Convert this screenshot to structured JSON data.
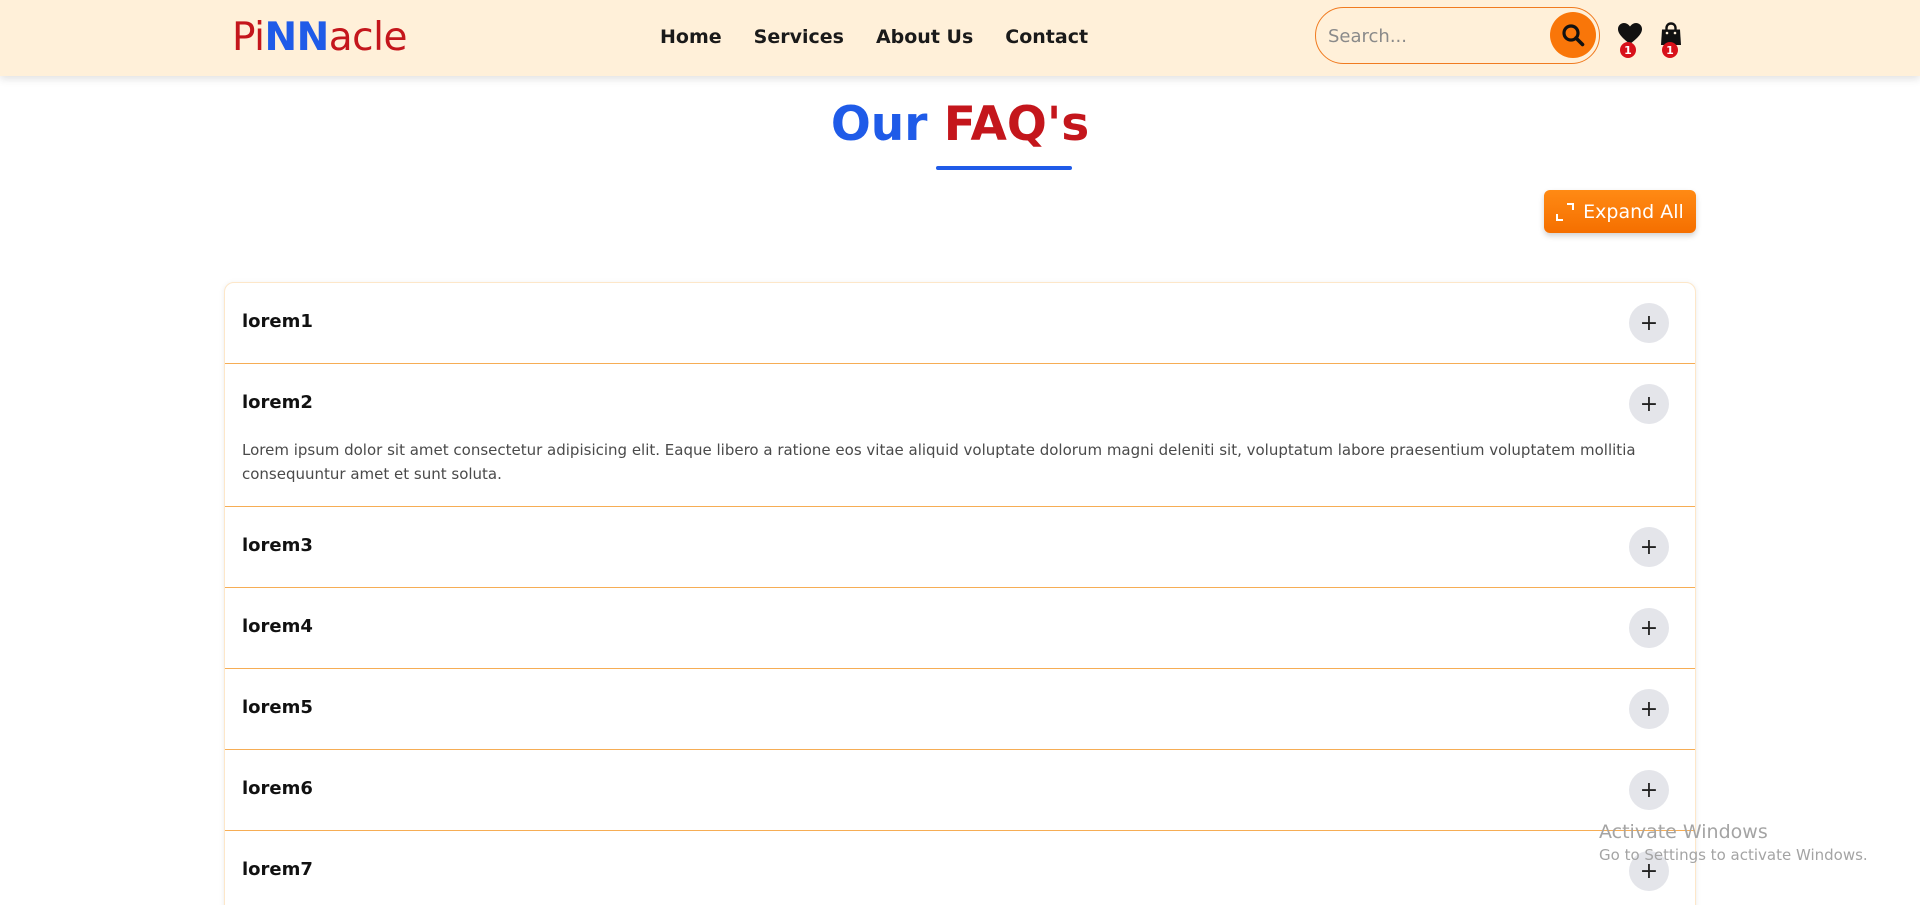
{
  "header": {
    "logo": {
      "part1": "Pi",
      "part2": "NN",
      "part3": "acle"
    },
    "nav": [
      "Home",
      "Services",
      "About Us",
      "Contact"
    ],
    "search": {
      "placeholder": "Search...",
      "value": ""
    },
    "wishlist_count": "1",
    "cart_count": "1",
    "colors": {
      "background": "#fff0d9",
      "accent": "#f97609",
      "brand_red": "#c4161c",
      "brand_blue": "#1f5be8"
    }
  },
  "page": {
    "title_part1": "Our",
    "title_part2": "FAQ's",
    "expand_all_label": "Expand All"
  },
  "faqs": [
    {
      "question": "lorem1",
      "expanded": false,
      "answer": ""
    },
    {
      "question": "lorem2",
      "expanded": true,
      "answer": "Lorem ipsum dolor sit amet consectetur adipisicing elit. Eaque libero a ratione eos vitae aliquid voluptate dolorum magni deleniti sit, voluptatum labore praesentium voluptatem mollitia consequuntur amet et sunt soluta."
    },
    {
      "question": "lorem3",
      "expanded": false,
      "answer": ""
    },
    {
      "question": "lorem4",
      "expanded": false,
      "answer": ""
    },
    {
      "question": "lorem5",
      "expanded": false,
      "answer": ""
    },
    {
      "question": "lorem6",
      "expanded": false,
      "answer": ""
    },
    {
      "question": "lorem7",
      "expanded": false,
      "answer": ""
    }
  ],
  "watermark": {
    "line1": "Activate Windows",
    "line2": "Go to Settings to activate Windows."
  }
}
